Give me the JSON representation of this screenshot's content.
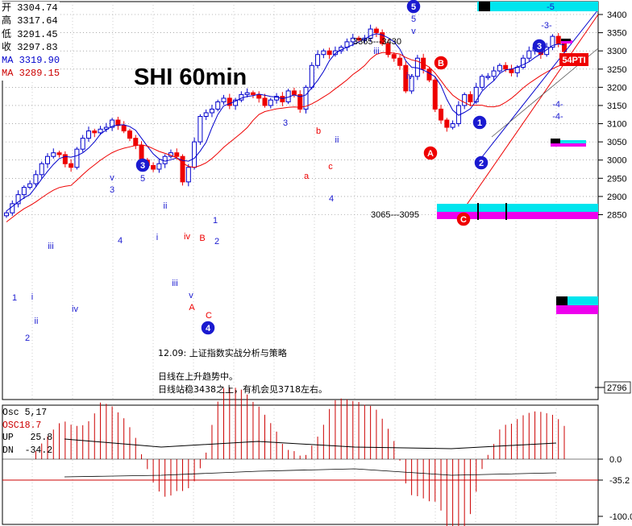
{
  "info": {
    "open_label": "开",
    "open_value": "3304.74",
    "high_label": "高",
    "high_value": "3317.64",
    "low_label": "低",
    "low_value": "3291.45",
    "close_label": "收",
    "close_value": "3297.83",
    "ma1_label": "MA",
    "ma1_value": "3319.90",
    "ma2_label": "MA",
    "ma2_value": "3289.15"
  },
  "title": "SHI 60min",
  "notes": {
    "line1": "12.09: 上证指数实战分析与策略",
    "line2": "日线在上升趋势中。",
    "line3": "日线站稳3438之上，有机会见3718左右。"
  },
  "oscillator": {
    "name_label": "Osc 5,17",
    "osc_label": "OSC",
    "osc_value": "18.7",
    "up_label": "UP",
    "up_value": "25.8",
    "dn_label": "DN",
    "dn_value": "-34.2",
    "axis_ticks": [
      "0.0",
      "-35.2",
      "-100.0"
    ]
  },
  "chart_data": {
    "type": "candlestick",
    "price_axis": {
      "ticks": [
        "3400",
        "3350",
        "3300",
        "3250",
        "3200",
        "3150",
        "3100",
        "3050",
        "3000",
        "2950",
        "2900",
        "2850"
      ],
      "current_marker": "2796",
      "ylim": [
        2796,
        3410
      ]
    },
    "overlays": [
      "MA 3319.90",
      "MA 3289.15"
    ],
    "range_labels": [
      "3365---3430",
      "3065---3095"
    ],
    "wave_labels": {
      "circled": [
        "1",
        "2",
        "3",
        "4",
        "5",
        "A",
        "B",
        "C"
      ],
      "plain": [
        "1",
        "2",
        "i",
        "ii",
        "iii",
        "iv",
        "v",
        "3",
        "5",
        "4",
        "B",
        "A",
        "C",
        "a",
        "b",
        "c",
        "-3-",
        "-4-",
        "-5"
      ],
      "tag": "54PTI"
    },
    "approx_close_path": [
      2855,
      2880,
      2905,
      2925,
      2935,
      2960,
      2990,
      3010,
      3020,
      3015,
      2990,
      2980,
      3030,
      3060,
      3080,
      3075,
      3085,
      3090,
      3110,
      3095,
      3080,
      3060,
      3040,
      3000,
      2985,
      2975,
      2990,
      3010,
      3020,
      3010,
      2940,
      2980,
      3050,
      3120,
      3130,
      3140,
      3160,
      3170,
      3150,
      3165,
      3180,
      3185,
      3180,
      3170,
      3150,
      3165,
      3175,
      3160,
      3190,
      3180,
      3140,
      3200,
      3260,
      3290,
      3300,
      3290,
      3300,
      3310,
      3325,
      3335,
      3330,
      3335,
      3360,
      3350,
      3320,
      3290,
      3280,
      3260,
      3190,
      3230,
      3280,
      3250,
      3220,
      3140,
      3110,
      3090,
      3100,
      3150,
      3180,
      3160,
      3200,
      3230,
      3230,
      3245,
      3260,
      3250,
      3240,
      3255,
      3280,
      3300,
      3310,
      3290,
      3310,
      3340,
      3320,
      3298
    ]
  }
}
